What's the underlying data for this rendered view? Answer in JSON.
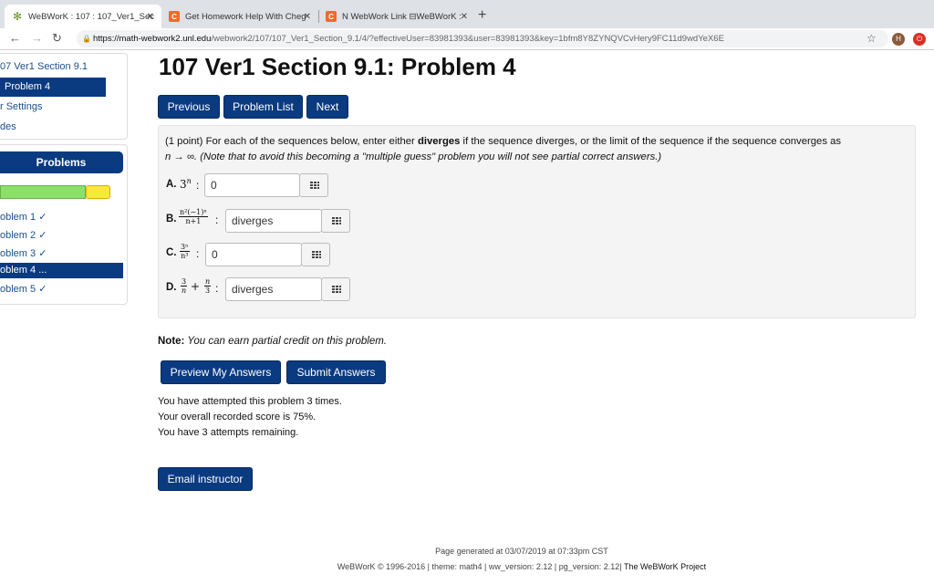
{
  "browser": {
    "tabs": [
      {
        "title": "WeBWorK : 107 : 107_Ver1_Sec"
      },
      {
        "title": "Get Homework Help With Cheg"
      },
      {
        "title": "N WebWork Link ⊟WeBWorK :"
      }
    ],
    "url_host": "https://math-webwork2.unl.edu",
    "url_path": "/webwork2/107/107_Ver1_Section_9.1/4/?effectiveUser=83981393&user=83981393&key=1bfm8Y8ZYNQVCvHery9FC11d9wdYeX6E",
    "avatar_letter": "H"
  },
  "sidebar": {
    "links": [
      {
        "label": "07 Ver1 Section 9.1"
      },
      {
        "label": "Problem 4"
      },
      {
        "label": "r Settings"
      },
      {
        "label": "des"
      }
    ],
    "problems_header": "Problems",
    "progress": {
      "correct_fraction": 0.78,
      "incorrect_fraction": 0.22
    },
    "problem_items": [
      {
        "label": "oblem 1 ✓"
      },
      {
        "label": "oblem 2 ✓"
      },
      {
        "label": "oblem 3 ✓"
      },
      {
        "label": "oblem 4 ..."
      },
      {
        "label": "oblem 5 ✓"
      }
    ]
  },
  "main": {
    "title": "107 Ver1 Section 9.1: Problem 4",
    "nav_buttons": {
      "previous": "Previous",
      "problem_list": "Problem List",
      "next": "Next"
    },
    "intro_prefix": "(1 point) For each of the sequences below, enter either ",
    "intro_bold": "diverges",
    "intro_middle": " if the sequence diverges, or the limit of the sequence if the sequence converges as",
    "intro_arrow": "n → ∞.",
    "intro_note": " (Note that to avoid this becoming a \"multiple guess\" problem you will not see partial correct answers.)",
    "parts": {
      "a": {
        "label": "A.",
        "base": "3",
        "exp": "n",
        "value": "0"
      },
      "b": {
        "label": "B.",
        "num": "n²(−1)ⁿ",
        "den": "n+1",
        "value": "diverges"
      },
      "c": {
        "label": "C.",
        "num": "3ⁿ",
        "den": "n³",
        "value": "0"
      },
      "d": {
        "label": "D.",
        "num1": "3",
        "den1": "n",
        "plus": "+",
        "num2": "n",
        "den2": "3",
        "value": "diverges"
      }
    },
    "colon": ":",
    "note_label": "Note:",
    "note_text": " You can earn partial credit on this problem.",
    "preview_button": "Preview My Answers",
    "submit_button": "Submit Answers",
    "status_lines": [
      "You have attempted this problem 3 times.",
      "Your overall recorded score is 75%.",
      "You have 3 attempts remaining."
    ],
    "email_button": "Email instructor"
  },
  "footer": {
    "generated": "Page generated at 03/07/2019 at 07:33pm CST",
    "credits": "WeBWorK © 1996-2016 | theme: math4 | ww_version: 2.12 | pg_version: 2.12| ",
    "project_link": "The WeBWorK Project"
  }
}
